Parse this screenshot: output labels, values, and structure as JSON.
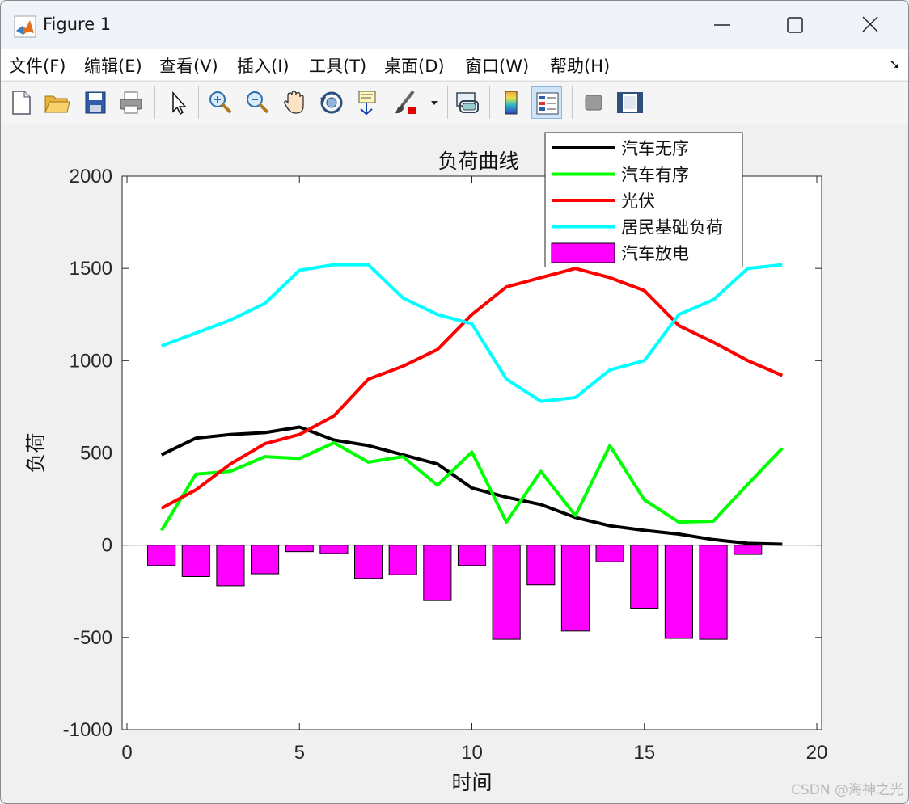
{
  "window": {
    "title": "Figure 1"
  },
  "menu": {
    "items": [
      "文件(F)",
      "编辑(E)",
      "查看(V)",
      "插入(I)",
      "工具(T)",
      "桌面(D)",
      "窗口(W)",
      "帮助(H)"
    ]
  },
  "toolbar": {
    "icons": [
      "new-file-icon",
      "open-folder-icon",
      "save-icon",
      "print-icon",
      "pointer-icon",
      "zoom-in-icon",
      "zoom-out-icon",
      "pan-hand-icon",
      "rotate-3d-icon",
      "data-cursor-icon",
      "brush-icon",
      "brush-dropdown-icon",
      "link-plot-icon",
      "colorbar-icon",
      "legend-icon",
      "hide-plot-tools-icon",
      "show-plot-tools-icon"
    ]
  },
  "colors": {
    "black": "#000000",
    "green": "#00ff00",
    "red": "#ff0000",
    "cyan": "#00ffff",
    "magenta": "#ff00ff"
  },
  "chart_data": {
    "type": "line",
    "title": "负荷曲线",
    "xlabel": "时间",
    "ylabel": "负荷",
    "xlim": [
      0,
      20
    ],
    "ylim": [
      -1000,
      2000
    ],
    "xticks": [
      0,
      5,
      10,
      15,
      20
    ],
    "yticks": [
      -1000,
      -500,
      0,
      500,
      1000,
      1500,
      2000
    ],
    "legend_position": "top-right",
    "x": [
      1,
      2,
      3,
      4,
      5,
      6,
      7,
      8,
      9,
      10,
      11,
      12,
      13,
      14,
      15,
      16,
      17,
      18,
      19
    ],
    "series": [
      {
        "name": "汽车无序",
        "type": "line",
        "color": "#000000",
        "values": [
          490,
          580,
          600,
          610,
          640,
          570,
          540,
          490,
          440,
          310,
          260,
          220,
          150,
          105,
          80,
          60,
          30,
          10,
          5
        ]
      },
      {
        "name": "汽车有序",
        "type": "line",
        "color": "#00ff00",
        "values": [
          80,
          385,
          400,
          480,
          470,
          555,
          450,
          480,
          325,
          505,
          125,
          400,
          160,
          540,
          245,
          125,
          130,
          330,
          525
        ]
      },
      {
        "name": "光伏",
        "type": "line",
        "color": "#ff0000",
        "values": [
          200,
          300,
          440,
          550,
          600,
          700,
          900,
          970,
          1060,
          1250,
          1400,
          1450,
          1500,
          1450,
          1380,
          1190,
          1100,
          1000,
          920
        ]
      },
      {
        "name": "居民基础负荷",
        "type": "line",
        "color": "#00ffff",
        "values": [
          1080,
          1150,
          1220,
          1310,
          1490,
          1520,
          1520,
          1340,
          1250,
          1200,
          900,
          780,
          800,
          950,
          1000,
          1250,
          1330,
          1500,
          1520
        ]
      },
      {
        "name": "汽车放电",
        "type": "bar",
        "color": "#ff00ff",
        "values": [
          -110,
          -170,
          -220,
          -155,
          -35,
          -45,
          -180,
          -160,
          -300,
          -110,
          -510,
          -215,
          -465,
          -90,
          -345,
          -505,
          -510,
          -50,
          0
        ]
      }
    ]
  },
  "watermark": "CSDN @海神之光"
}
